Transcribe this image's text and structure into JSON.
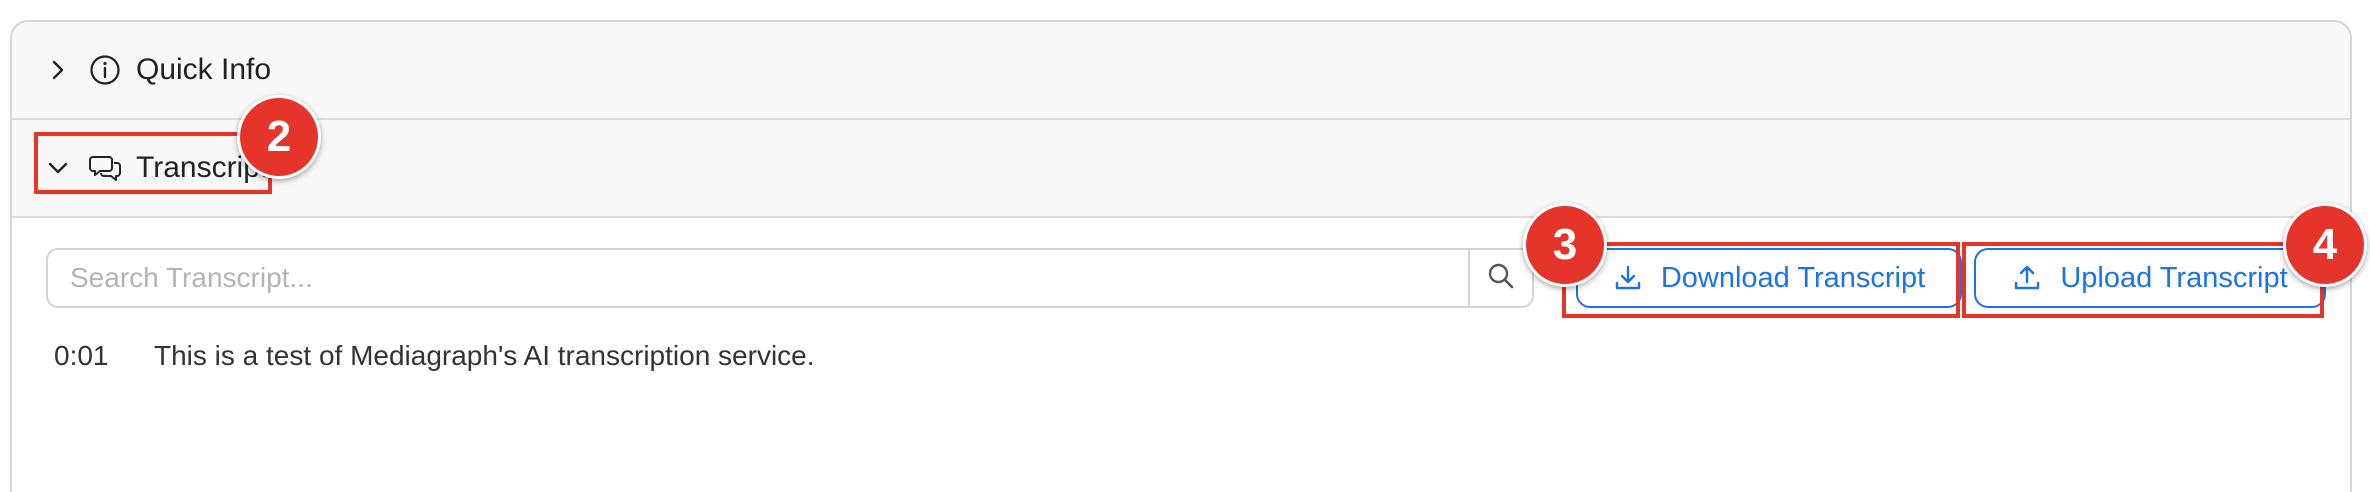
{
  "sections": {
    "quick_info": {
      "label": "Quick Info",
      "expanded": false,
      "icon": "info-circle-icon"
    },
    "transcript": {
      "label": "Transcript",
      "expanded": true,
      "icon": "chat-bubbles-icon"
    }
  },
  "search": {
    "placeholder": "Search Transcript..."
  },
  "buttons": {
    "download": {
      "label": "Download Transcript",
      "icon": "download-icon"
    },
    "upload": {
      "label": "Upload Transcript",
      "icon": "upload-icon"
    }
  },
  "transcript_lines": [
    {
      "time": "0:01",
      "text": "This is a test of Mediagraph's AI transcription service."
    }
  ],
  "annotations": {
    "marker_2": "2",
    "marker_3": "3",
    "marker_4": "4"
  },
  "colors": {
    "accent": "#1a73e8",
    "marker": "#e5352a",
    "border": "#d6d6d6"
  }
}
